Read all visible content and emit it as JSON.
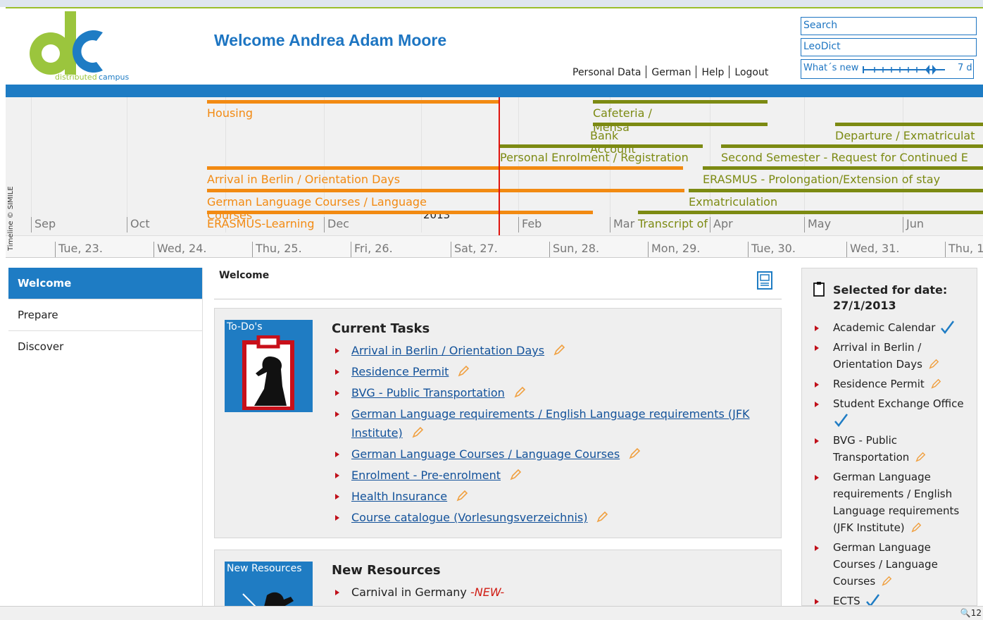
{
  "header": {
    "welcome": "Welcome Andrea Adam Moore",
    "logo_text_distributed": "distributed",
    "logo_text_campus": "campus",
    "links": [
      "Personal Data",
      "German",
      "Help",
      "Logout"
    ],
    "search_label": "Search",
    "leodict_label": "LeoDict",
    "whatsnew_label": "What´s new",
    "whatsnew_value": "7 d"
  },
  "timeline": {
    "credit": "Timeline © SIMILE",
    "months": [
      "Sep",
      "Oct",
      "Dec",
      "Feb",
      "Mar",
      "Apr",
      "May",
      "Jun"
    ],
    "year": "2013",
    "days": [
      "Tue, 23.",
      "Wed, 24.",
      "Thu, 25.",
      "Fri, 26.",
      "Sat, 27.",
      "Sun, 28.",
      "Mon, 29.",
      "Tue, 30.",
      "Wed, 31.",
      "Thu, 1"
    ],
    "events": {
      "housing": "Housing",
      "cafeteria": "Cafeteria /",
      "mensa": "Mensa",
      "bank": "Bank",
      "account": "Account",
      "departure": "Departure / Exmatriculat",
      "enrolment": "Personal Enrolment / Registration",
      "second_semester": "Second Semester - Request for Continued E",
      "arrival": "Arrival in Berlin / Orientation Days",
      "erasmus_prolong": "ERASMUS - Prolongation/Extension of stay",
      "german_courses": "German Language Courses / Language",
      "courses": "Courses",
      "exmatriculation": "Exmatriculation",
      "erasmus_learning": "ERASMUS-Learning",
      "transcript": "Transcript of"
    },
    "colors": {
      "orange": "#f28a12",
      "olive": "#7c8a12",
      "today": "#e0140e"
    }
  },
  "nav": {
    "items": [
      "Welcome",
      "Prepare",
      "Discover"
    ],
    "active": "Welcome"
  },
  "main": {
    "title": "Welcome",
    "todo": {
      "image_label": "To-Do's",
      "heading": "Current Tasks",
      "tasks": [
        "Arrival in Berlin / Orientation Days",
        "Residence Permit",
        "BVG - Public Transportation",
        "German Language requirements / English Language requirements (JFK Institute)",
        "German Language Courses / Language Courses",
        "Enrolment - Pre-enrolment",
        "Health Insurance",
        "Course catalogue (Vorlesungsverzeichnis)"
      ]
    },
    "resources": {
      "image_label": "New Resources",
      "heading": "New Resources",
      "item": "Carnival in Germany",
      "new_tag": "-NEW-"
    }
  },
  "sidebar_right": {
    "heading": "Selected for date:",
    "date": "27/1/2013",
    "items": [
      "Academic Calendar",
      "Arrival in Berlin / Orientation Days",
      "Residence Permit",
      "Student Exchange Office",
      "BVG - Public Transportation",
      "German Language requirements / English Language requirements (JFK Institute)",
      "German Language Courses / Language Courses",
      "ECTS"
    ]
  },
  "status": {
    "zoom": "12"
  }
}
